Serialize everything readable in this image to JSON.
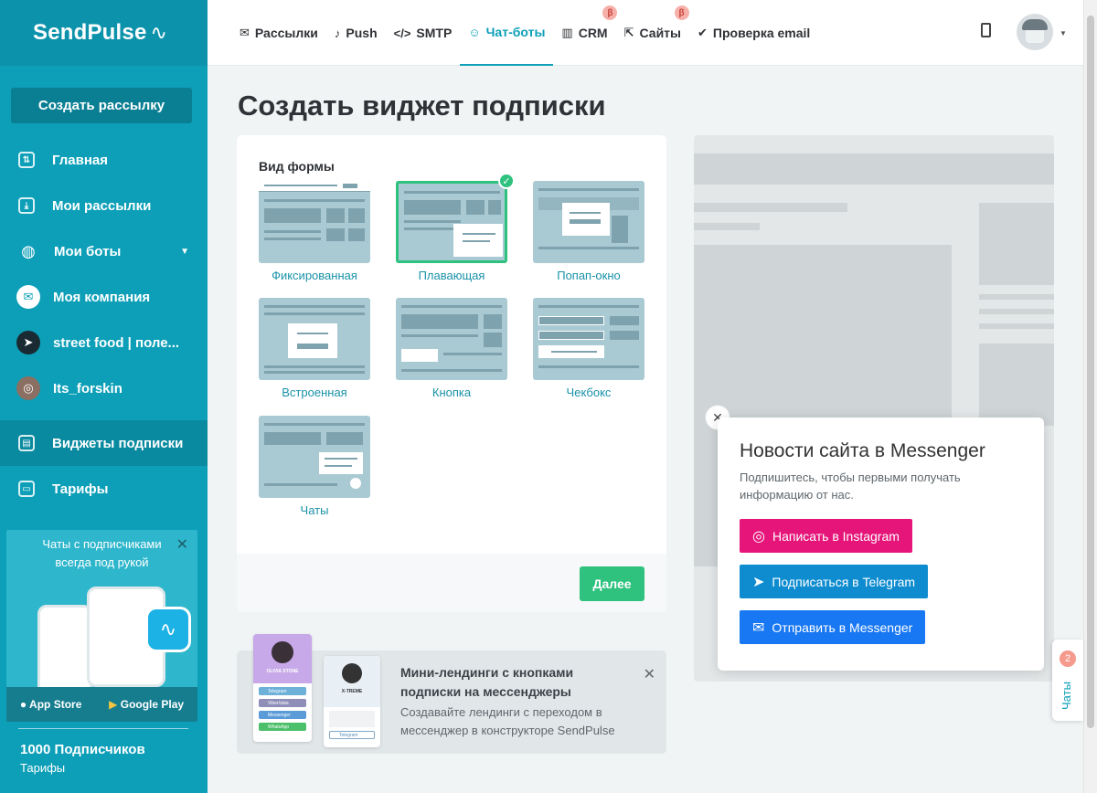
{
  "brand": {
    "logo": "SendPulse"
  },
  "sidebar": {
    "create_label": "Создать рассылку",
    "items": [
      {
        "label": "Главная",
        "icon": "sliders-icon"
      },
      {
        "label": "Мои рассылки",
        "icon": "inbox-icon"
      },
      {
        "label": "Мои боты",
        "icon": "globe-icon"
      },
      {
        "label": "Моя компания",
        "icon": "messenger-icon"
      },
      {
        "label": "street food | поле...",
        "icon": "telegram-icon"
      },
      {
        "label": "Its_forskin",
        "icon": "instagram-icon"
      },
      {
        "label": "Виджеты подписки",
        "icon": "widget-icon"
      },
      {
        "label": "Тарифы",
        "icon": "wallet-icon"
      }
    ],
    "promo": {
      "text": "Чаты с подписчиками всегда под рукой",
      "app_store": "App Store",
      "google_play": "Google Play"
    },
    "subscribers": "1000 Подписчиков",
    "tariffs_link": "Тарифы"
  },
  "topbar": {
    "tabs": [
      {
        "label": "Рассылки",
        "icon": "mail-icon"
      },
      {
        "label": "Push",
        "icon": "bell-icon"
      },
      {
        "label": "SMTP",
        "icon": "code-icon"
      },
      {
        "label": "Чат-боты",
        "icon": "chatbot-icon"
      },
      {
        "label": "CRM",
        "icon": "crm-icon",
        "beta": "β"
      },
      {
        "label": "Сайты",
        "icon": "sites-icon",
        "beta": "β"
      },
      {
        "label": "Проверка email",
        "icon": "check-circle-icon"
      }
    ],
    "active_tab": "Чат-боты"
  },
  "page": {
    "title": "Создать виджет подписки"
  },
  "form": {
    "label": "Вид формы",
    "options": [
      "Фиксированная",
      "Плавающая",
      "Попап-окно",
      "Встроенная",
      "Кнопка",
      "Чекбокс",
      "Чаты"
    ],
    "selected": "Плавающая",
    "next_label": "Далее"
  },
  "promo_card": {
    "title": "Мини-лендинги с кнопками подписки на мессенджеры",
    "desc": "Создавайте лендинги с переходом в мессенджер в конструкторе SendPulse",
    "mini1_name": "OLIVIA STONE",
    "mini1_buttons": [
      "Telegram",
      "Viber/data",
      "Messenger",
      "WhatsApp"
    ],
    "mini2_name": "X-TREME",
    "mini2_button": "Telegram"
  },
  "widget_preview": {
    "title": "Новости сайта в Messenger",
    "subtitle": "Подпишитесь, чтобы первыми получать информацию от нас.",
    "buttons": [
      {
        "label": "Написать в Instagram",
        "color": "#e6157a",
        "icon": "instagram-icon"
      },
      {
        "label": "Подписаться в Telegram",
        "color": "#0e8ccf",
        "icon": "telegram-icon"
      },
      {
        "label": "Отправить в Messenger",
        "color": "#1877f2",
        "icon": "messenger-icon"
      }
    ]
  },
  "chats_tab": {
    "label": "Чаты",
    "count": "2"
  },
  "colors": {
    "brand": "#0d9fb8",
    "success": "#2ec27e"
  }
}
